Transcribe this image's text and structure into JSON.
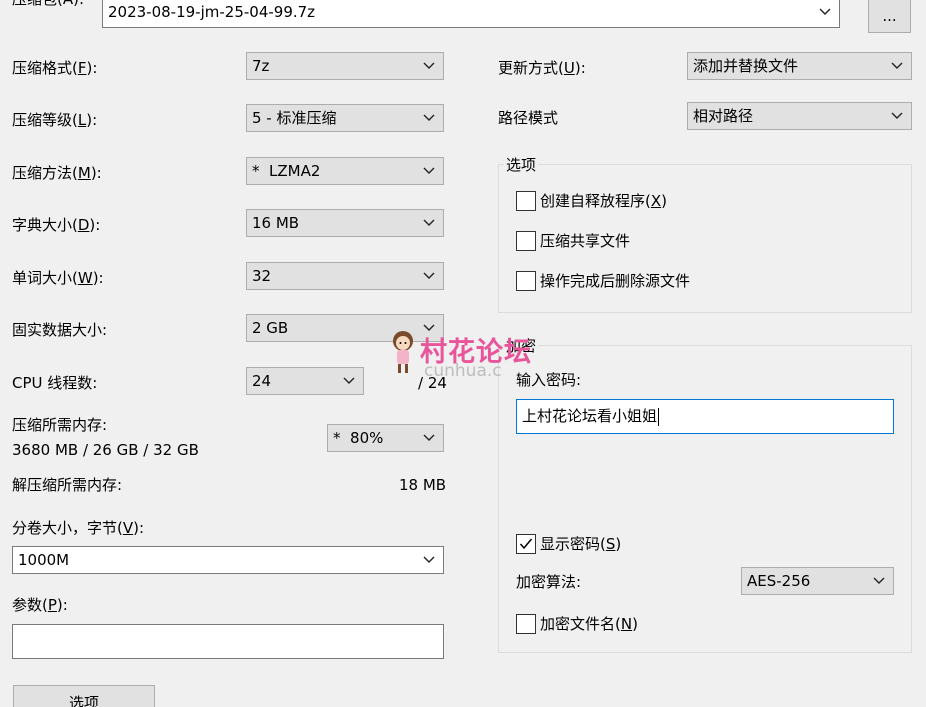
{
  "archive": {
    "label_partial": "压缩包(A):",
    "path": "2023-08-19-jm-25-04-99.7z",
    "browse_label": "..."
  },
  "left": {
    "format": {
      "label": "压缩格式(",
      "key": "F",
      "tail": "):",
      "value": "7z"
    },
    "level": {
      "label": "压缩等级(",
      "key": "L",
      "tail": "):",
      "value": "5 - 标准压缩"
    },
    "method": {
      "label": "压缩方法(",
      "key": "M",
      "tail": "):",
      "value": "*  LZMA2"
    },
    "dict": {
      "label": "字典大小(",
      "key": "D",
      "tail": "):",
      "value": "16 MB"
    },
    "word": {
      "label": "单词大小(",
      "key": "W",
      "tail": "):",
      "value": "32"
    },
    "solid": {
      "label": "固实数据大小:",
      "value": "2 GB"
    },
    "cpu": {
      "label": "CPU 线程数:",
      "value": "24",
      "max": "/ 24"
    },
    "mem_compress": {
      "label": "压缩所需内存:",
      "value": "3680 MB / 26 GB / 32 GB",
      "percent": "*  80%"
    },
    "mem_decompress": {
      "label": "解压缩所需内存:",
      "value": "18 MB"
    },
    "volume": {
      "label": "分卷大小，字节(",
      "key": "V",
      "tail": "):",
      "value": "1000M"
    },
    "params": {
      "label": "参数(",
      "key": "P",
      "tail": "):",
      "value": ""
    },
    "options_button": "选项"
  },
  "right": {
    "update": {
      "label": "更新方式(",
      "key": "U",
      "tail": "):",
      "value": "添加并替换文件"
    },
    "path_mode": {
      "label": "路径模式",
      "value": "相对路径"
    },
    "options_group": {
      "title": "选项",
      "sfx": {
        "label": "创建自释放程序(",
        "key": "X",
        "tail": ")",
        "checked": false
      },
      "shared": {
        "label": "压缩共享文件",
        "checked": false
      },
      "delete": {
        "label": "操作完成后删除源文件",
        "checked": false
      }
    },
    "encrypt_group": {
      "title": "加密",
      "password_label": "输入密码:",
      "password_value": "上村花论坛看小姐姐",
      "show_password": {
        "label": "显示密码(",
        "key": "S",
        "tail": ")",
        "checked": true
      },
      "algo_label": "加密算法:",
      "algo_value": "AES-256",
      "encrypt_names": {
        "label": "加密文件名(",
        "key": "N",
        "tail": ")",
        "checked": false
      }
    }
  },
  "watermark": {
    "text": "村花论坛",
    "sub": "cunhua.c"
  }
}
